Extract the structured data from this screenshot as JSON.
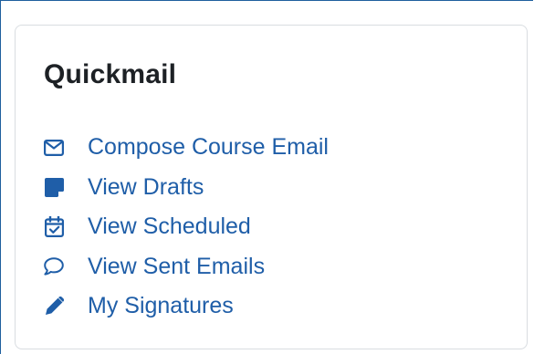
{
  "block": {
    "title": "Quickmail",
    "items": [
      {
        "label": "Compose Course Email",
        "icon": "envelope-icon"
      },
      {
        "label": "View Drafts",
        "icon": "sticky-note-icon"
      },
      {
        "label": "View Scheduled",
        "icon": "calendar-check-icon"
      },
      {
        "label": "View Sent Emails",
        "icon": "comment-icon"
      },
      {
        "label": "My Signatures",
        "icon": "pencil-icon"
      }
    ]
  },
  "colors": {
    "link": "#1f5ea8",
    "title": "#1d2125",
    "card_border": "#d9dde1",
    "frame_border": "#1f5f9e"
  }
}
